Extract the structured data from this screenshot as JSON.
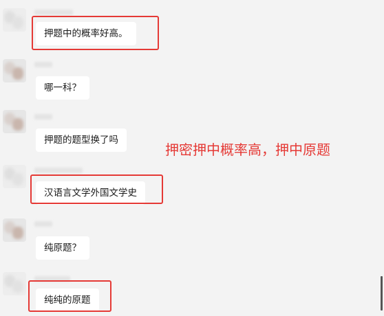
{
  "messages": [
    {
      "text": "押题中的概率好高。"
    },
    {
      "text": "哪一科？"
    },
    {
      "text": "押题的题型换了吗"
    },
    {
      "text": "汉语言文学外国文学史"
    },
    {
      "text": "纯原题？"
    },
    {
      "text": "纯纯的原题"
    }
  ],
  "annotation": "押密押中概率高，押中原题",
  "colors": {
    "highlight": "#e53935",
    "bubble": "#ffffff",
    "background": "#f3f3f3"
  }
}
